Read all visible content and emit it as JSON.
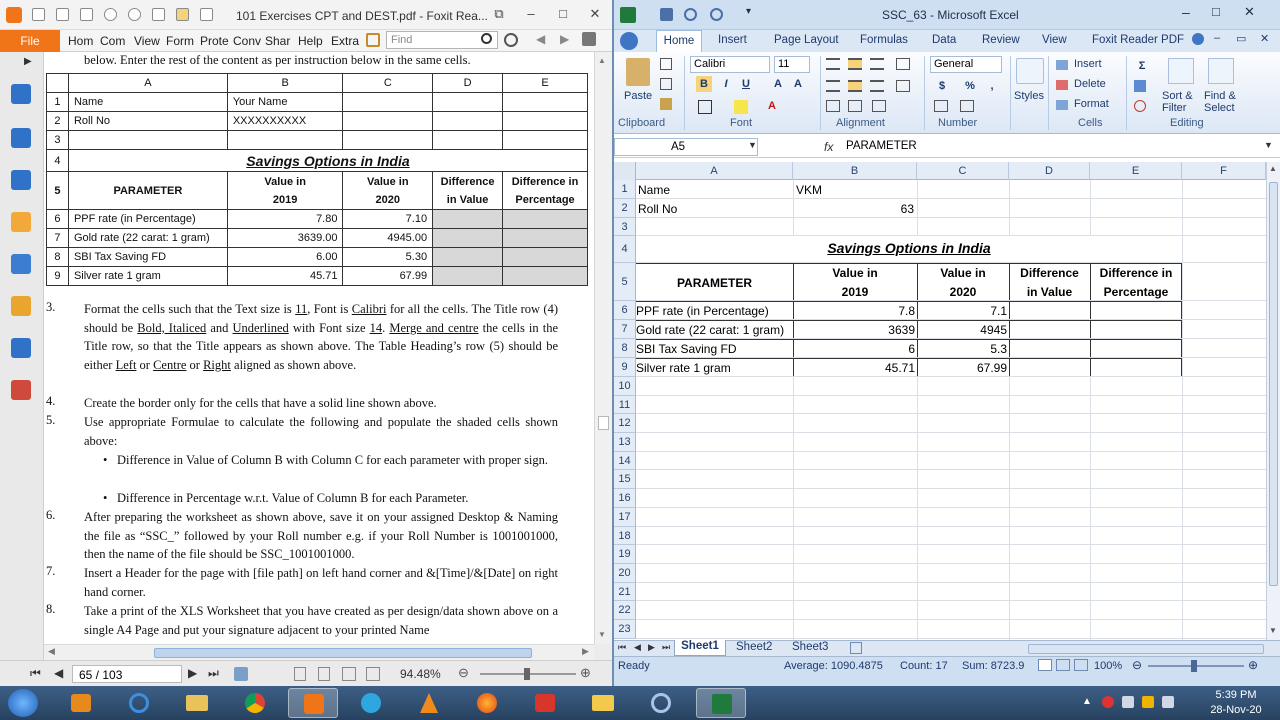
{
  "foxit": {
    "title": "101 Exercises CPT and DEST.pdf - Foxit Rea...",
    "menu": {
      "file": "File",
      "tabs": [
        "Hom",
        "Com",
        "View",
        "Form",
        "Prote",
        "Conv",
        "Shar",
        "Help",
        "Extra"
      ]
    },
    "find_placeholder": "Find",
    "page": {
      "intro": "below. Enter the rest of the content as per instruction below in the same cells.",
      "table": {
        "col_letters": [
          "A",
          "B",
          "C",
          "D",
          "E"
        ],
        "rows": [
          {
            "n": "1",
            "a": "Name",
            "b": "Your Name",
            "c": "",
            "d": "",
            "e": ""
          },
          {
            "n": "2",
            "a": "Roll No",
            "b": "XXXXXXXXXX",
            "c": "",
            "d": "",
            "e": ""
          },
          {
            "n": "3",
            "a": "",
            "b": "",
            "c": "",
            "d": "",
            "e": ""
          },
          {
            "n": "4",
            "title": "Savings Options in India"
          },
          {
            "n": "5",
            "a": "PARAMETER",
            "b1": "Value in",
            "b2": "2019",
            "c1": "Value in",
            "c2": "2020",
            "d1": "Difference",
            "d2": "in Value",
            "e1": "Difference in",
            "e2": "Percentage"
          },
          {
            "n": "6",
            "a": "PPF rate (in Percentage)",
            "b": "7.80",
            "c": "7.10"
          },
          {
            "n": "7",
            "a": "Gold rate (22 carat: 1 gram)",
            "b": "3639.00",
            "c": "4945.00"
          },
          {
            "n": "8",
            "a": "SBI Tax Saving FD",
            "b": "6.00",
            "c": "5.30"
          },
          {
            "n": "9",
            "a": "Silver rate 1 gram",
            "b": "45.71",
            "c": "67.99"
          }
        ]
      },
      "items": {
        "n3": "3.",
        "p3a": "Format the cells such that the Text size is ",
        "p3_11": "11",
        "p3b": ", Font is ",
        "p3_cal": "Calibri",
        "p3c": " for all the cells. The Title row (4) should be ",
        "p3_biu": "Bold, Italiced",
        "p3d": " and ",
        "p3_und": "Underlined",
        "p3e": " with Font size ",
        "p3_14": "14",
        "p3f": ". ",
        "p3_merge": "Merge and centre",
        "p3g": " the cells in the Title row, so that the Title appears as shown above. The Table Heading’s row (5) should be either ",
        "p3_left": "Left",
        "p3h": " or ",
        "p3_centre": "Centre",
        "p3i": " or ",
        "p3_right": "Right",
        "p3j": " aligned as shown above.",
        "n4": "4.",
        "p4": "Create the border only for the cells that have a solid line shown above.",
        "n5": "5.",
        "p5": "Use appropriate Formulae to calculate the following and populate the shaded cells shown above:",
        "b1": "Difference in Value of Column B with Column C for each parameter with proper sign.",
        "b2": "Difference in Percentage w.r.t. Value of Column B for each Parameter.",
        "n6": "6.",
        "p6": "After preparing the worksheet as shown above, save it on your assigned Desktop & Naming the file as “SSC_” followed by your Roll number e.g. if your Roll Number is 1001001000, then the name of the file should be SSC_1001001000.",
        "n7": "7.",
        "p7": "Insert a Header for the page with [file path] on left hand corner and &[Time]/&[Date] on right hand corner.",
        "n8": "8.",
        "p8": "Take a print of the XLS Worksheet that you have created as per design/data shown above on a single A4 Page and put  your signature adjacent to your printed Name"
      }
    },
    "status": {
      "page": "65 / 103",
      "zoom": "94.48%"
    }
  },
  "excel": {
    "title": "SSC_63 - Microsoft Excel",
    "tabs": [
      "Home",
      "Insert",
      "Page Layout",
      "Formulas",
      "Data",
      "Review",
      "View",
      "Foxit Reader PDF"
    ],
    "ribbon": {
      "paste": "Paste",
      "font_name": "Calibri",
      "font_size": "11",
      "number_format": "General",
      "styles": "Styles",
      "insert": "Insert",
      "delete": "Delete",
      "format": "Format",
      "sort": "Sort &",
      "filter": "Filter",
      "find": "Find &",
      "select": "Select",
      "groups": [
        "Clipboard",
        "Font",
        "Alignment",
        "Number",
        "Cells",
        "Editing"
      ]
    },
    "name_box": "A5",
    "formula": "PARAMETER",
    "columns": [
      "A",
      "B",
      "C",
      "D",
      "E",
      "F"
    ],
    "rows": [
      "1",
      "2",
      "3",
      "4",
      "5",
      "6",
      "7",
      "8",
      "9",
      "10",
      "11",
      "12",
      "13",
      "14",
      "15",
      "16",
      "17",
      "18",
      "19",
      "20",
      "21",
      "22",
      "23"
    ],
    "cells": {
      "a1": "Name",
      "b1": "VKM",
      "a2": "Roll No",
      "b2": "63",
      "title": "Savings Options in India",
      "h_a": "PARAMETER",
      "h_b1": "Value in",
      "h_b2": "2019",
      "h_c1": "Value in",
      "h_c2": "2020",
      "h_d1": "Difference",
      "h_d2": "in Value",
      "h_e1": "Difference in",
      "h_e2": "Percentage",
      "r6": [
        "PPF rate (in Percentage)",
        "7.8",
        "7.1"
      ],
      "r7": [
        "Gold rate (22 carat: 1 gram)",
        "3639",
        "4945"
      ],
      "r8": [
        "SBI Tax Saving FD",
        "6",
        "5.3"
      ],
      "r9": [
        "Silver rate 1 gram",
        "45.71",
        "67.99"
      ]
    },
    "sheets": [
      "Sheet1",
      "Sheet2",
      "Sheet3"
    ],
    "status": {
      "ready": "Ready",
      "average": "Average: 1090.4875",
      "count": "Count: 17",
      "sum": "Sum: 8723.9",
      "zoom": "100%"
    }
  },
  "taskbar": {
    "time": "5:39 PM",
    "date": "28-Nov-20"
  }
}
